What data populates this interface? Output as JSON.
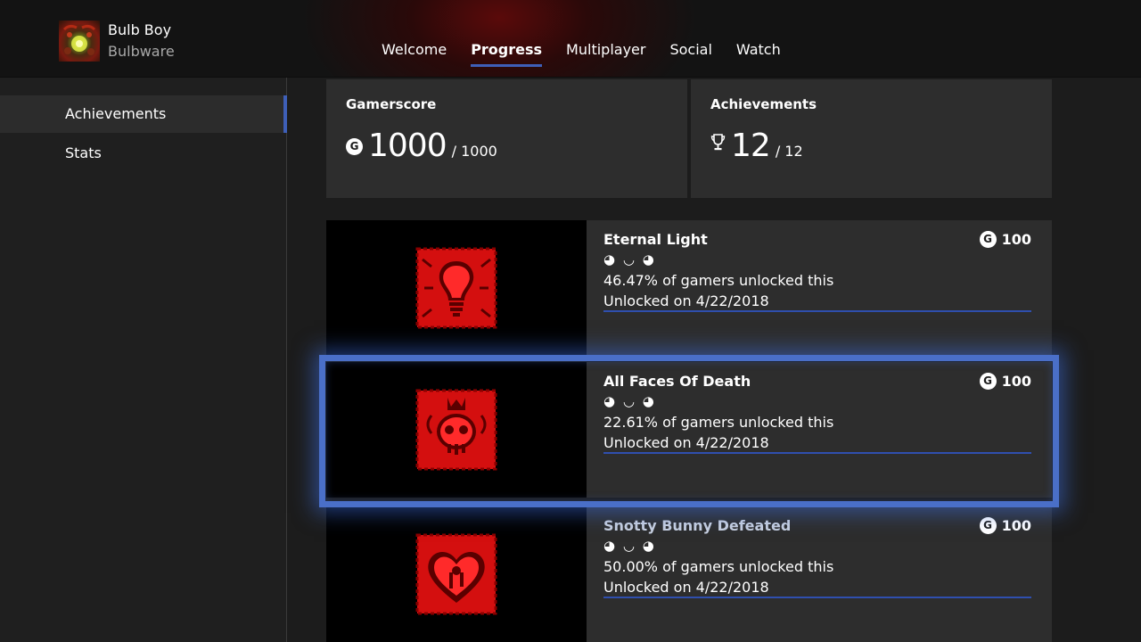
{
  "header": {
    "game_title": "Bulb Boy",
    "publisher": "Bulbware",
    "tabs": [
      {
        "label": "Welcome"
      },
      {
        "label": "Progress",
        "active": true
      },
      {
        "label": "Multiplayer"
      },
      {
        "label": "Social"
      },
      {
        "label": "Watch"
      }
    ]
  },
  "sidebar": {
    "items": [
      {
        "label": "Achievements",
        "selected": true
      },
      {
        "label": "Stats"
      }
    ]
  },
  "gamerscore": {
    "title": "Gamerscore",
    "icon": "G",
    "value": "1000",
    "total": "/ 1000"
  },
  "achievements_summary": {
    "title": "Achievements",
    "value": "12",
    "total": "/ 12"
  },
  "achievements": [
    {
      "name": "Eternal Light",
      "points": "100",
      "faces": "◕ ◡ ◕",
      "percent": "46.47% of gamers unlocked this",
      "unlocked": "Unlocked on 4/22/2018",
      "icon": "lightbulb-icon",
      "progress": 1.0
    },
    {
      "name": "All Faces Of Death",
      "points": "100",
      "faces": "◕ ◡ ◕",
      "percent": "22.61% of gamers unlocked this",
      "unlocked": "Unlocked on 4/22/2018",
      "icon": "skull-crown-icon",
      "progress": 1.0,
      "focused": true
    },
    {
      "name": "Snotty Bunny Defeated",
      "points": "100",
      "faces": "◕ ◡ ◕",
      "percent": "50.00% of gamers unlocked this",
      "unlocked": "Unlocked on 4/22/2018",
      "icon": "heart-splat-icon",
      "progress": 1.0
    }
  ],
  "colors": {
    "accent": "#3e5fb8",
    "focus": "#4a6fc8",
    "icon_red": "#e01010"
  }
}
